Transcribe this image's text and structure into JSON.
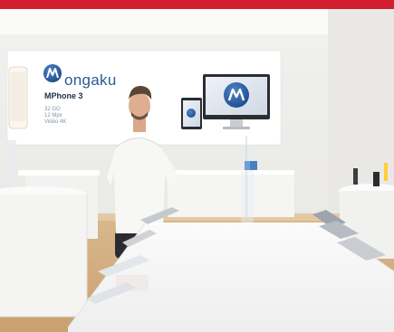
{
  "photo": {
    "scene": "electronics-store",
    "accent_color": "#d21f2f",
    "brand_color": "#2a5a9a"
  },
  "banner": {
    "brand": "ongaku",
    "product": "MPhone 3",
    "specs": [
      "32 GO",
      "12 Mpx",
      "Vidéo 4K"
    ]
  }
}
